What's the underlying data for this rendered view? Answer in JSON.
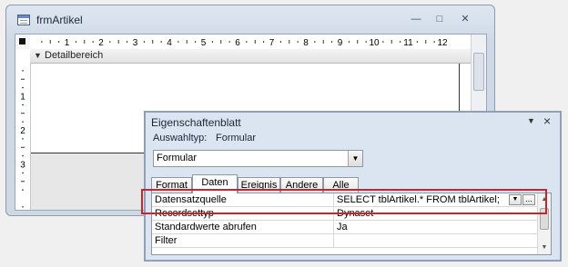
{
  "form_window": {
    "title": "frmArtikel",
    "minimize_glyph": "—",
    "restore_glyph": "□",
    "close_glyph": "✕",
    "section_label": "Detailbereich",
    "ruler_numbers": [
      "1",
      "2",
      "3",
      "4",
      "5",
      "6",
      "7",
      "8",
      "9",
      "10",
      "11",
      "12"
    ],
    "vruler_numbers": [
      "1",
      "2",
      "3"
    ]
  },
  "property_sheet": {
    "title": "Eigenschaftenblatt",
    "selection_type_label": "Auswahltyp:",
    "selection_type_value": "Formular",
    "object_combo_value": "Formular",
    "tabs": [
      {
        "label": "Format",
        "active": false
      },
      {
        "label": "Daten",
        "active": true
      },
      {
        "label": "Ereignis",
        "active": false
      },
      {
        "label": "Andere",
        "active": false
      },
      {
        "label": "Alle",
        "active": false
      }
    ],
    "rows": [
      {
        "name": "Datensatzquelle",
        "value": "SELECT tblArtikel.* FROM tblArtikel;"
      },
      {
        "name": "Recordsettyp",
        "value": "Dynaset"
      },
      {
        "name": "Standardwerte abrufen",
        "value": "Ja"
      },
      {
        "name": "Filter",
        "value": ""
      }
    ]
  },
  "colors": {
    "highlight": "#c0282d",
    "window_frame": "#8d9aae"
  }
}
